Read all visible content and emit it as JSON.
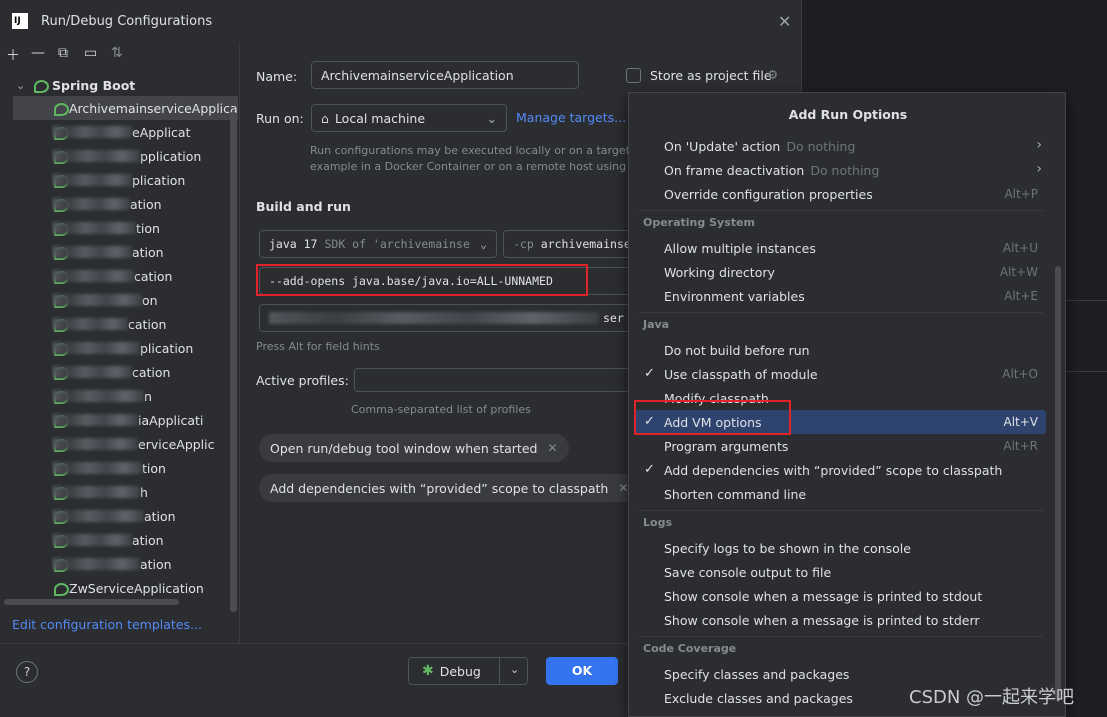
{
  "window": {
    "title": "Run/Debug Configurations",
    "logo": "IJ"
  },
  "toolbar": [
    "add-icon",
    "remove-icon",
    "copy-icon",
    "folder-icon",
    "sort-icon"
  ],
  "tree": {
    "group": "Spring Boot",
    "items": [
      {
        "label": "ArchivemainserviceApplicatio",
        "selected": true
      },
      {
        "label": "eApplicat"
      },
      {
        "label": "pplication"
      },
      {
        "label": "plication"
      },
      {
        "label": "ation"
      },
      {
        "label": "tion"
      },
      {
        "label": "ation"
      },
      {
        "label": "cation"
      },
      {
        "label": "on"
      },
      {
        "label": "cation"
      },
      {
        "label": "plication"
      },
      {
        "label": "cation"
      },
      {
        "label": "n"
      },
      {
        "label": "iaApplicati"
      },
      {
        "label": "erviceApplic"
      },
      {
        "label": "tion"
      },
      {
        "label": "h"
      },
      {
        "label": "ation"
      },
      {
        "label": "ation"
      },
      {
        "label": "ation"
      },
      {
        "label": "ZwServiceApplication"
      }
    ],
    "edit_templates": "Edit configuration templates..."
  },
  "form": {
    "name_label": "Name:",
    "name_value": "ArchivemainserviceApplication",
    "store_label": "Store as project file",
    "run_on_label": "Run on:",
    "run_on_value": "Local machine",
    "manage_targets": "Manage targets...",
    "run_on_hint_1": "Run configurations may be executed locally or on a target: fo",
    "run_on_hint_2": "example in a Docker Container or on a remote host using SSH",
    "build_run": "Build and run",
    "jdk_version": "java 17",
    "jdk_sdk": "SDK of 'archivemainse",
    "cp_prefix": "-cp",
    "cp_value": "archivemainse",
    "vm_options": "--add-opens java.base/java.io=ALL-UNNAMED",
    "main_class_suffix": "ser",
    "field_hint": "Press Alt for field hints",
    "active_profiles_label": "Active profiles:",
    "profiles_hint": "Comma-separated list of profiles",
    "chip_1": "Open run/debug tool window when started",
    "chip_2": "Add dependencies with “provided” scope to classpath"
  },
  "footer": {
    "help": "?",
    "debug": "Debug",
    "ok": "OK"
  },
  "popup": {
    "title": "Add Run Options",
    "top_items": [
      {
        "label": "On 'Update' action",
        "sub": "Do nothing",
        "submenu": true
      },
      {
        "label": "On frame deactivation",
        "sub": "Do nothing",
        "submenu": true
      },
      {
        "label": "Override configuration properties",
        "shortcut": "Alt+P"
      }
    ],
    "os_title": "Operating System",
    "os_items": [
      {
        "label": "Allow multiple instances",
        "shortcut": "Alt+U"
      },
      {
        "label": "Working directory",
        "shortcut": "Alt+W"
      },
      {
        "label": "Environment variables",
        "shortcut": "Alt+E"
      }
    ],
    "java_title": "Java",
    "java_items": [
      {
        "label": "Do not build before run"
      },
      {
        "label": "Use classpath of module",
        "shortcut": "Alt+O",
        "checked": true
      },
      {
        "label": "Modify classpath"
      },
      {
        "label": "Add VM options",
        "shortcut": "Alt+V",
        "checked": true,
        "highlighted": true
      },
      {
        "label": "Program arguments",
        "shortcut": "Alt+R"
      },
      {
        "label": "Add dependencies with “provided” scope to classpath",
        "checked": true
      },
      {
        "label": "Shorten command line"
      }
    ],
    "logs_title": "Logs",
    "logs_items": [
      {
        "label": "Specify logs to be shown in the console"
      },
      {
        "label": "Save console output to file"
      },
      {
        "label": "Show console when a message is printed to stdout"
      },
      {
        "label": "Show console when a message is printed to stderr"
      }
    ],
    "coverage_title": "Code Coverage",
    "coverage_items": [
      {
        "label": "Specify classes and packages"
      },
      {
        "label": "Exclude classes and packages"
      }
    ]
  },
  "watermark": "CSDN @一起来学吧",
  "colors": {
    "accent": "#3574f0",
    "highlight": "#2e436e",
    "annotation": "#e0242a",
    "spring": "#5fb85f"
  }
}
